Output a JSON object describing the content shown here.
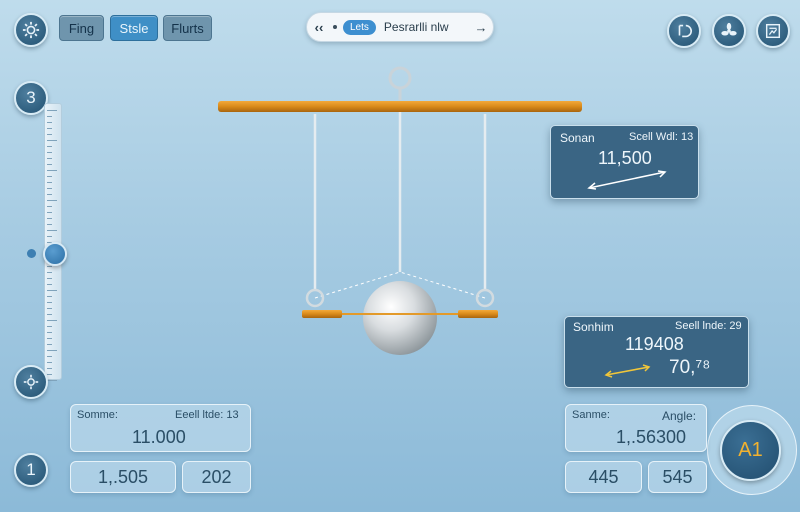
{
  "toolbar": {
    "tabs": [
      {
        "label": "Fing",
        "active": false
      },
      {
        "label": "Stsle",
        "active": true
      },
      {
        "label": "Flurts",
        "active": false
      }
    ]
  },
  "nav": {
    "back_icon": "chevron-left-icon",
    "chip": "Lets",
    "label": "Pesrarlli nlw",
    "forward_icon": "arrow-right-icon"
  },
  "top_right_icons": [
    "settings-icon",
    "fan-icon",
    "chart-icon"
  ],
  "sidebar": {
    "top_badge": "3",
    "bottom_badge": "1",
    "tool_icon": "gear-icon",
    "slider_value": 0.5
  },
  "panel_force": {
    "label": "Sonan",
    "index_label": "Scell Wdl: 13",
    "value": "11,500"
  },
  "panel_angle": {
    "label": "Sonhim",
    "index_label": "Seell lnde: 29",
    "value": "119408",
    "sub_value": "70,⁷⁸"
  },
  "bottom_left": {
    "label": "Somme:",
    "index_label": "Eeell ltde: 13",
    "value": "11.000",
    "box1": "1,.505",
    "box2": "202"
  },
  "bottom_right": {
    "label": "Sanme:",
    "angle_label": "Angle:",
    "value": "1,.56300",
    "box1": "445",
    "box2": "545",
    "badge": "A1"
  },
  "colors": {
    "accent": "#3f8fc6",
    "bar": "#d98a1a",
    "panel_dark": "#3a6584",
    "badge_text": "#f2b22e"
  }
}
